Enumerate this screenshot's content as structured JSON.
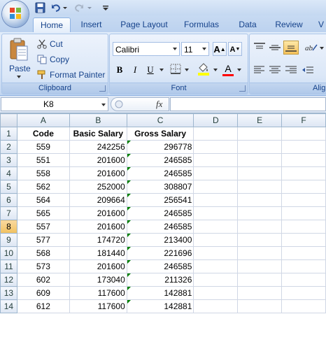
{
  "qat": {
    "icons": [
      "office-logo",
      "save-icon",
      "undo-icon",
      "redo-icon",
      "customize-icon"
    ]
  },
  "tabs": [
    {
      "label": "Home",
      "active": true
    },
    {
      "label": "Insert",
      "active": false
    },
    {
      "label": "Page Layout",
      "active": false
    },
    {
      "label": "Formulas",
      "active": false
    },
    {
      "label": "Data",
      "active": false
    },
    {
      "label": "Review",
      "active": false
    },
    {
      "label": "V",
      "active": false
    }
  ],
  "ribbon": {
    "clipboard": {
      "paste_label": "Paste",
      "cut_label": "Cut",
      "copy_label": "Copy",
      "format_painter_label": "Format Painter",
      "group_label": "Clipboard"
    },
    "font": {
      "font_name": "Calibri",
      "font_size": "11",
      "bold": "B",
      "italic": "I",
      "underline": "U",
      "font_color_glyph": "A",
      "group_label": "Font"
    },
    "alignment": {
      "group_label": "Alig"
    }
  },
  "formula_bar": {
    "cell_ref": "K8",
    "fx": "fx",
    "formula": ""
  },
  "sheet": {
    "column_headers": [
      "A",
      "B",
      "C",
      "D",
      "E",
      "F"
    ],
    "header_row": [
      "Code",
      "Basic Salary",
      "Gross Salary"
    ],
    "selected_row": 8,
    "rows": [
      {
        "num": "2",
        "code": "559",
        "basic": "242256",
        "gross": "296778"
      },
      {
        "num": "3",
        "code": "551",
        "basic": "201600",
        "gross": "246585"
      },
      {
        "num": "4",
        "code": "558",
        "basic": "201600",
        "gross": "246585"
      },
      {
        "num": "5",
        "code": "562",
        "basic": "252000",
        "gross": "308807"
      },
      {
        "num": "6",
        "code": "564",
        "basic": "209664",
        "gross": "256541"
      },
      {
        "num": "7",
        "code": "565",
        "basic": "201600",
        "gross": "246585"
      },
      {
        "num": "8",
        "code": "557",
        "basic": "201600",
        "gross": "246585"
      },
      {
        "num": "9",
        "code": "577",
        "basic": "174720",
        "gross": "213400"
      },
      {
        "num": "10",
        "code": "568",
        "basic": "181440",
        "gross": "221696"
      },
      {
        "num": "11",
        "code": "573",
        "basic": "201600",
        "gross": "246585"
      },
      {
        "num": "12",
        "code": "602",
        "basic": "173040",
        "gross": "211326"
      },
      {
        "num": "13",
        "code": "609",
        "basic": "117600",
        "gross": "142881"
      },
      {
        "num": "14",
        "code": "612",
        "basic": "117600",
        "gross": "142881"
      }
    ],
    "header_row_num": "1"
  },
  "colors": {
    "ribbon_text": "#15428b",
    "selected_row_header": "#f1c15f",
    "error_flag": "#008000"
  }
}
